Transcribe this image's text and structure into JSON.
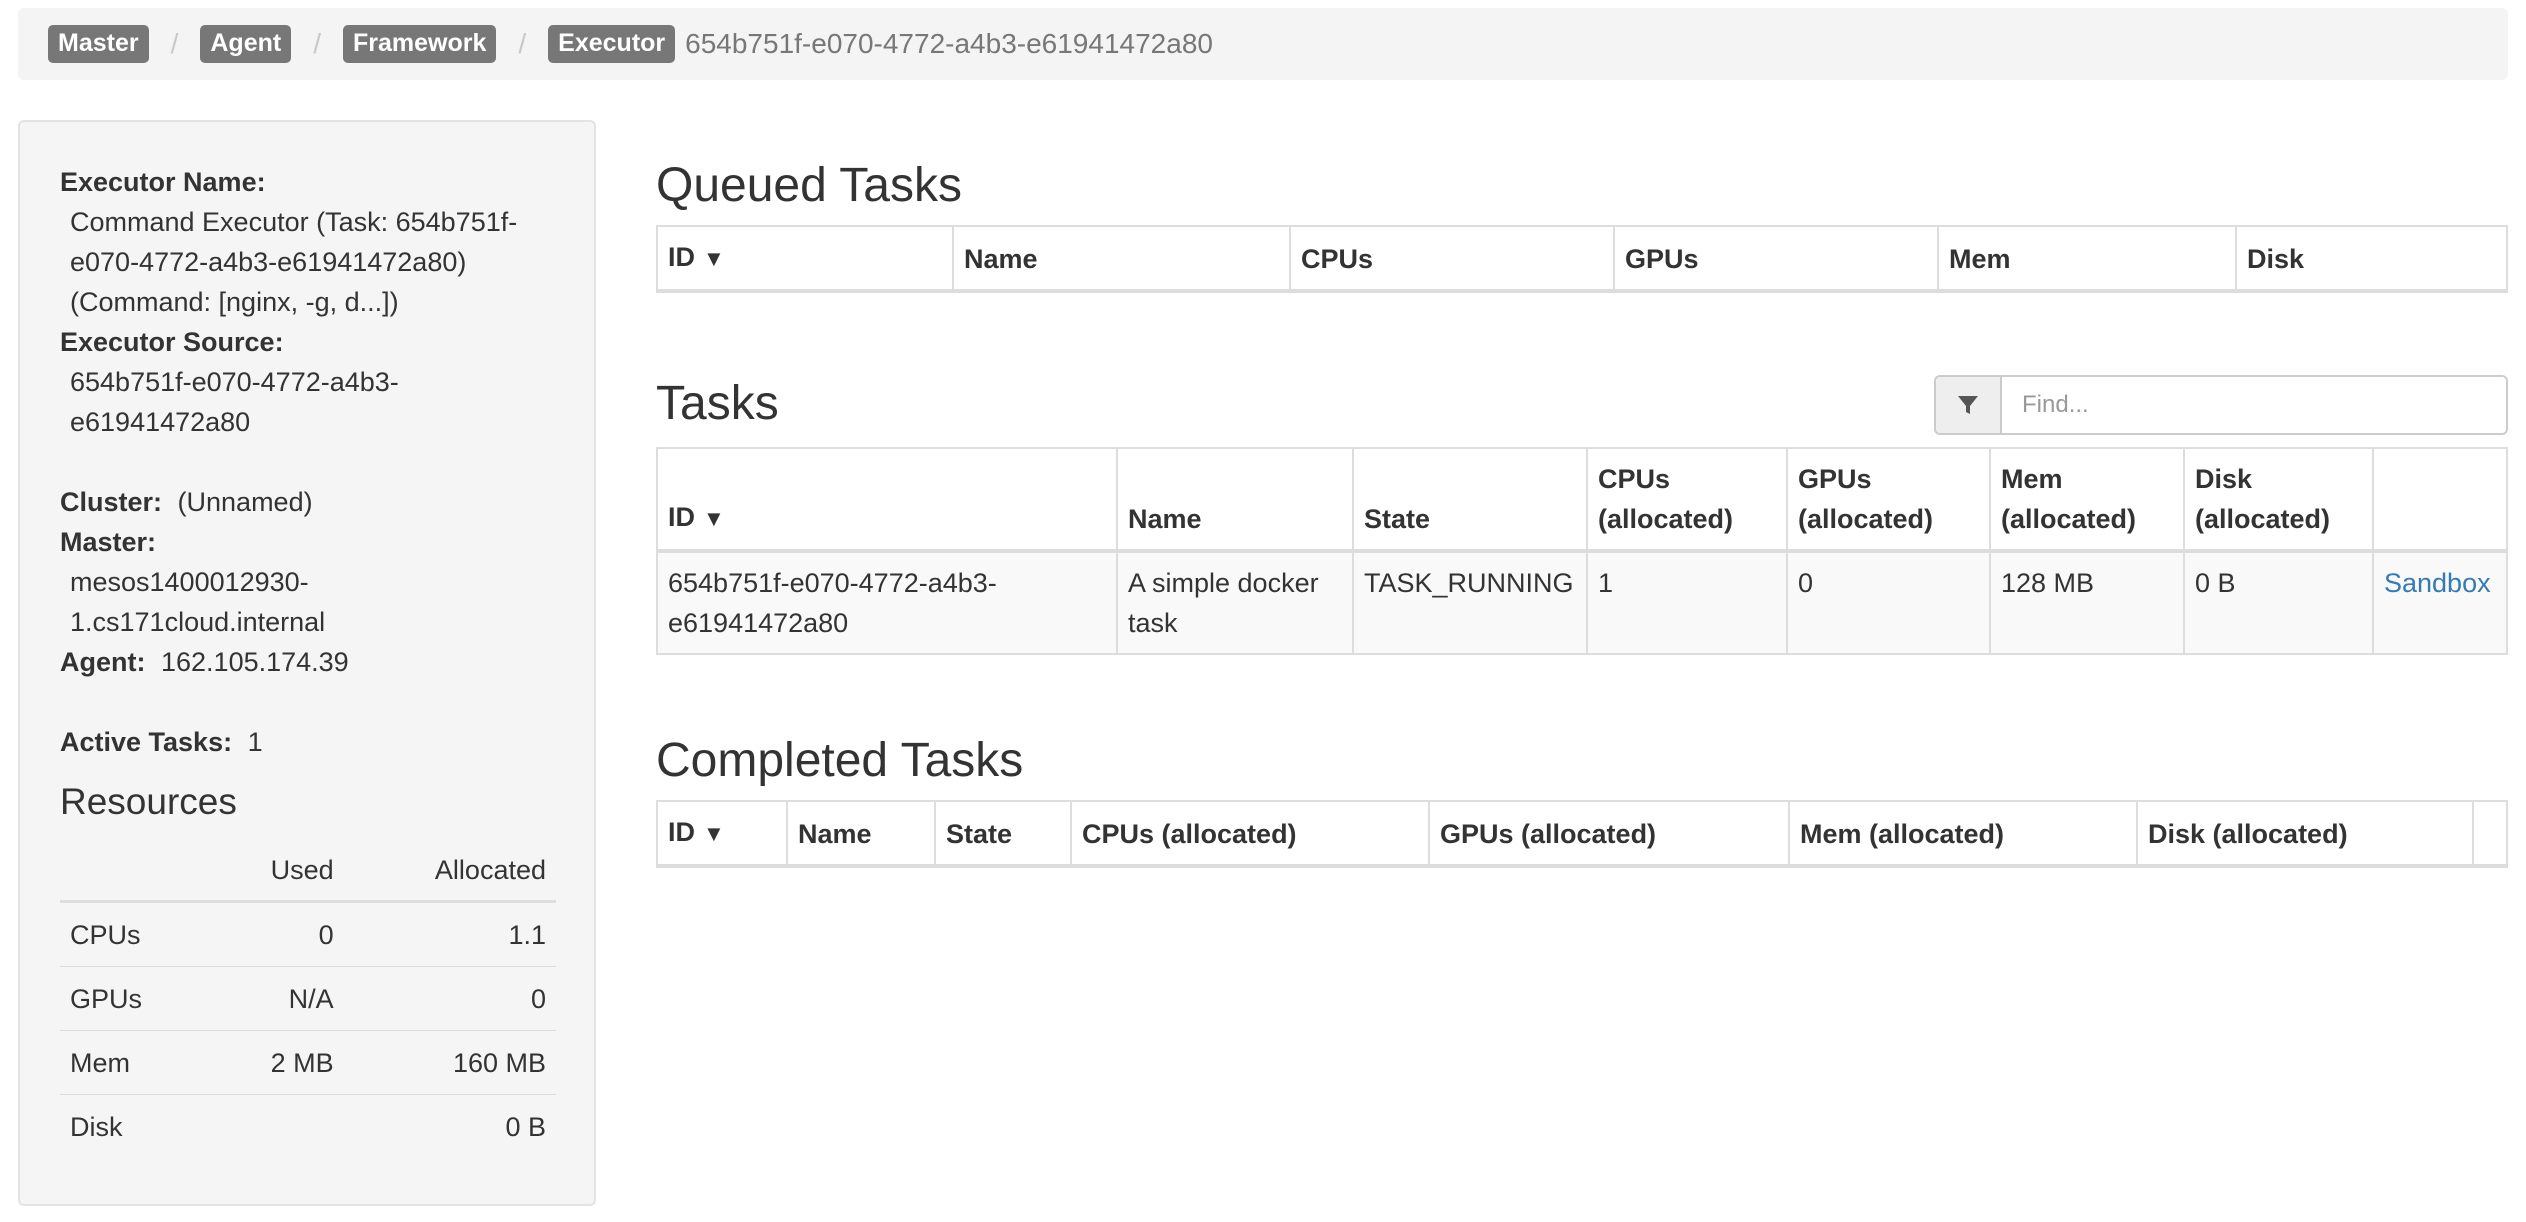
{
  "breadcrumb": {
    "items": [
      "Master",
      "Agent",
      "Framework",
      "Executor"
    ],
    "separator": "/",
    "executor_id": "654b751f-e070-4772-a4b3-e61941472a80"
  },
  "sidebar": {
    "executor_name_label": "Executor Name:",
    "executor_name_line1": "Command Executor (Task: 654b751f-",
    "executor_name_line2": "e070-4772-a4b3-e61941472a80)",
    "executor_name_line3": "(Command: [nginx, -g, d...])",
    "executor_source_label": "Executor Source:",
    "executor_source_line1": "654b751f-e070-4772-a4b3-",
    "executor_source_line2": "e61941472a80",
    "cluster_label": "Cluster:",
    "cluster_value": "(Unnamed)",
    "master_label": "Master:",
    "master_line1": "mesos1400012930-",
    "master_line2": "1.cs171cloud.internal",
    "agent_label": "Agent:",
    "agent_value": "162.105.174.39",
    "active_tasks_label": "Active Tasks:",
    "active_tasks_value": "1",
    "resources_title": "Resources",
    "resources_headers": [
      "",
      "Used",
      "Allocated"
    ],
    "resources_rows": [
      [
        "CPUs",
        "0",
        "1.1"
      ],
      [
        "GPUs",
        "N/A",
        "0"
      ],
      [
        "Mem",
        "2 MB",
        "160 MB"
      ],
      [
        "Disk",
        "",
        "0 B"
      ]
    ]
  },
  "queued": {
    "title": "Queued Tasks",
    "headers": [
      "ID",
      "Name",
      "CPUs",
      "GPUs",
      "Mem",
      "Disk"
    ],
    "sort_indicator": "▼"
  },
  "tasks": {
    "title": "Tasks",
    "filter_placeholder": "Find...",
    "headers": {
      "id": "ID",
      "name": "Name",
      "state": "State",
      "cpus": [
        "CPUs",
        "(allocated)"
      ],
      "gpus": [
        "GPUs",
        "(allocated)"
      ],
      "mem": [
        "Mem",
        "(allocated)"
      ],
      "disk": [
        "Disk",
        "(allocated)"
      ]
    },
    "sort_indicator": "▼",
    "rows": [
      {
        "id_line1": "654b751f-e070-4772-a4b3-",
        "id_line2": "e61941472a80",
        "name_line1": "A simple docker",
        "name_line2": "task",
        "state": "TASK_RUNNING",
        "cpus": "1",
        "gpus": "0",
        "mem": "128 MB",
        "disk": "0 B",
        "sandbox": "Sandbox"
      }
    ]
  },
  "completed": {
    "title": "Completed Tasks",
    "headers": [
      "ID",
      "Name",
      "State",
      "CPUs (allocated)",
      "GPUs (allocated)",
      "Mem (allocated)",
      "Disk (allocated)"
    ],
    "sort_indicator": "▼"
  },
  "colors": {
    "badge_bg": "#777777",
    "link": "#337ab7",
    "sidebar_bg": "#f5f5f5",
    "breadcrumb_bg": "#f4f4f4"
  }
}
